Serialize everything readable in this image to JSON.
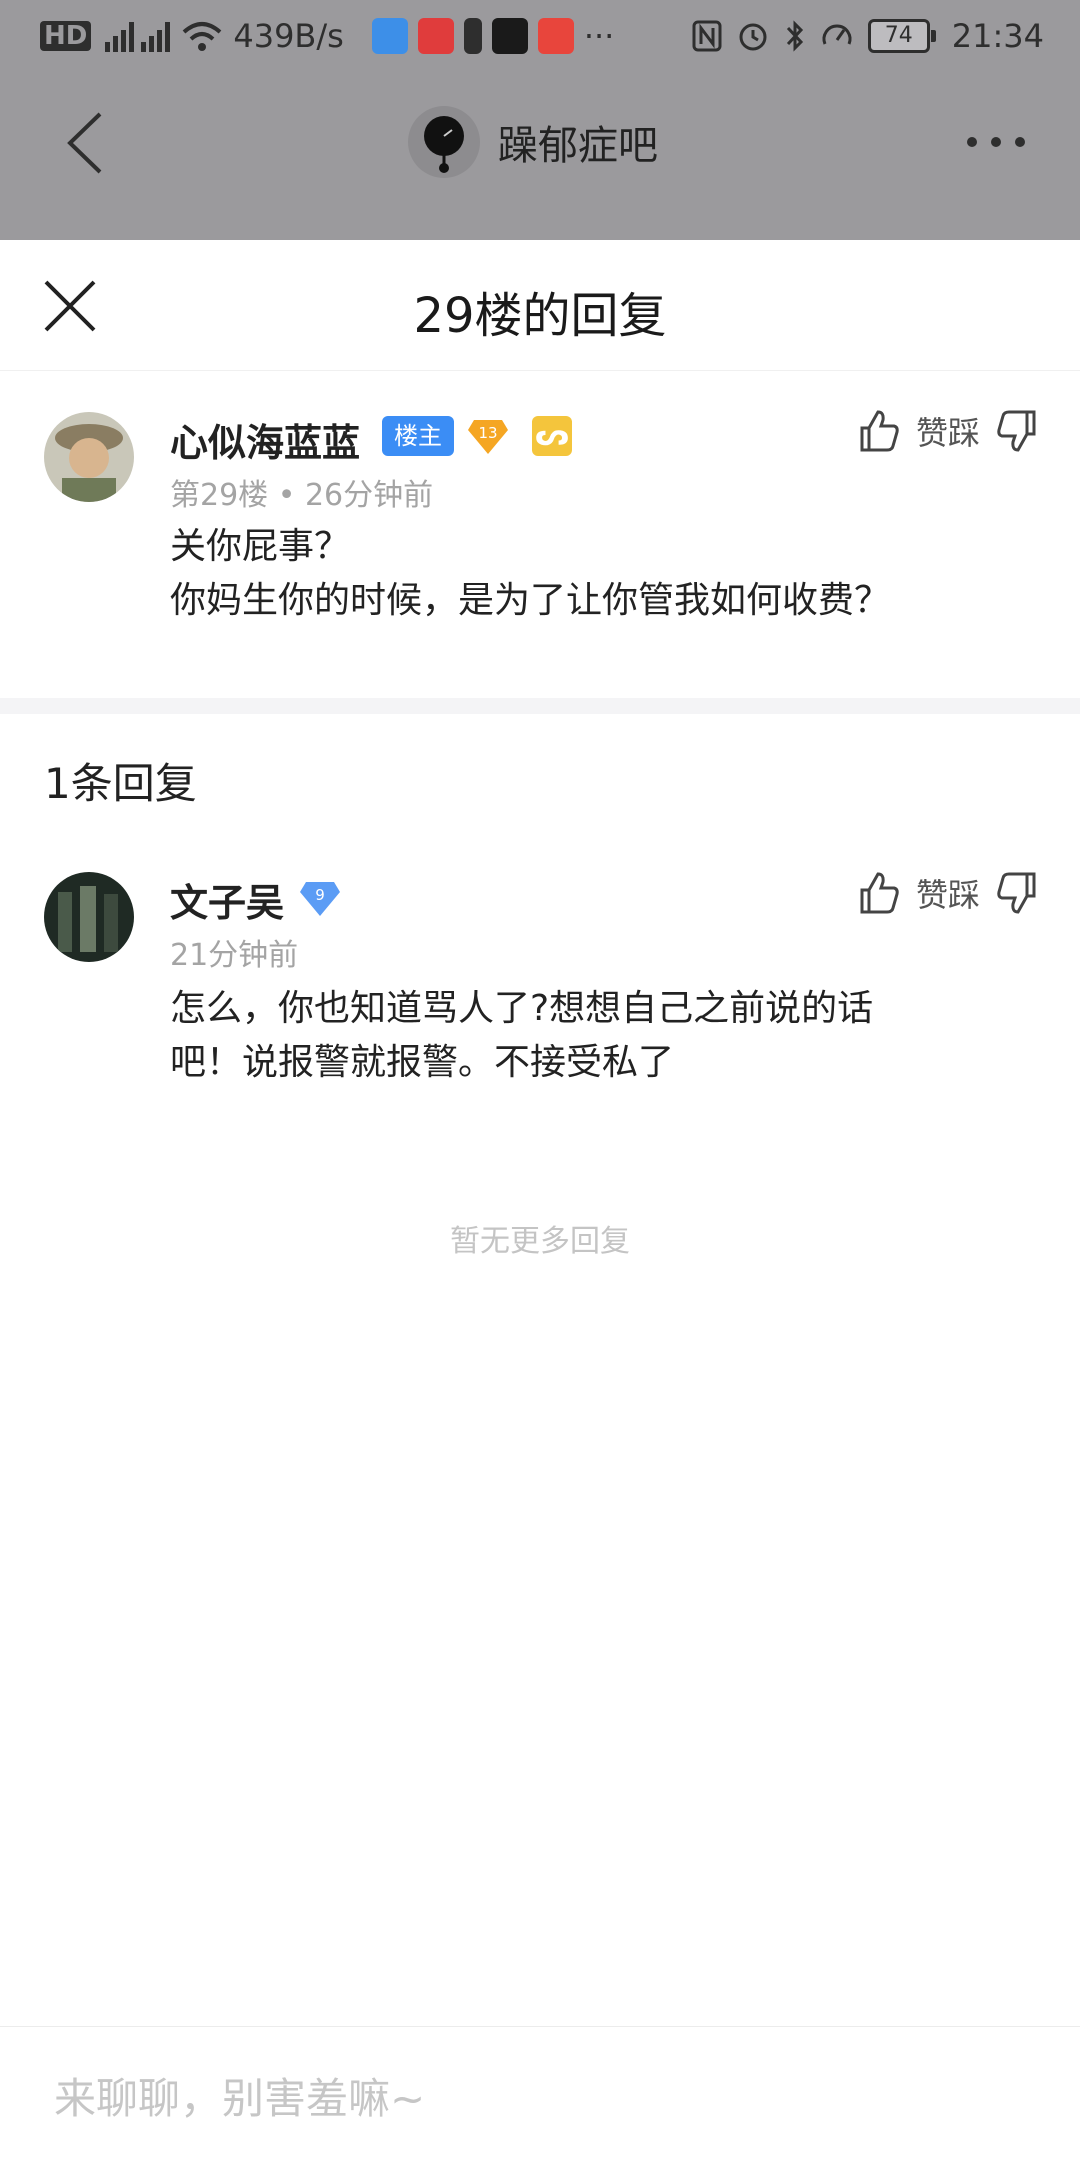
{
  "status_bar": {
    "network_speed": "439B/s",
    "more_indicator": "···",
    "battery": "74",
    "time": "21:34"
  },
  "top_nav": {
    "forum_name": "躁郁症吧"
  },
  "sheet": {
    "title": "29楼的回复"
  },
  "main_post": {
    "username": "心似海蓝蓝",
    "owner_badge": "楼主",
    "level": "13",
    "meta": "第29楼 • 26分钟前",
    "content_lines": [
      "关你屁事？",
      "你妈生你的时候，是为了让你管我如何收费？"
    ],
    "vote_label": "赞踩"
  },
  "replies_section": {
    "count_label": "1条回复",
    "replies": [
      {
        "username": "文子吴",
        "level": "9",
        "time": "21分钟前",
        "content_lines": [
          "怎么，你也知道骂人了?想想自己之前说的话",
          "吧！说报警就报警。不接受私了"
        ],
        "vote_label": "赞踩"
      }
    ],
    "no_more": "暂无更多回复"
  },
  "input": {
    "placeholder": "来聊聊，别害羞嘛~"
  }
}
